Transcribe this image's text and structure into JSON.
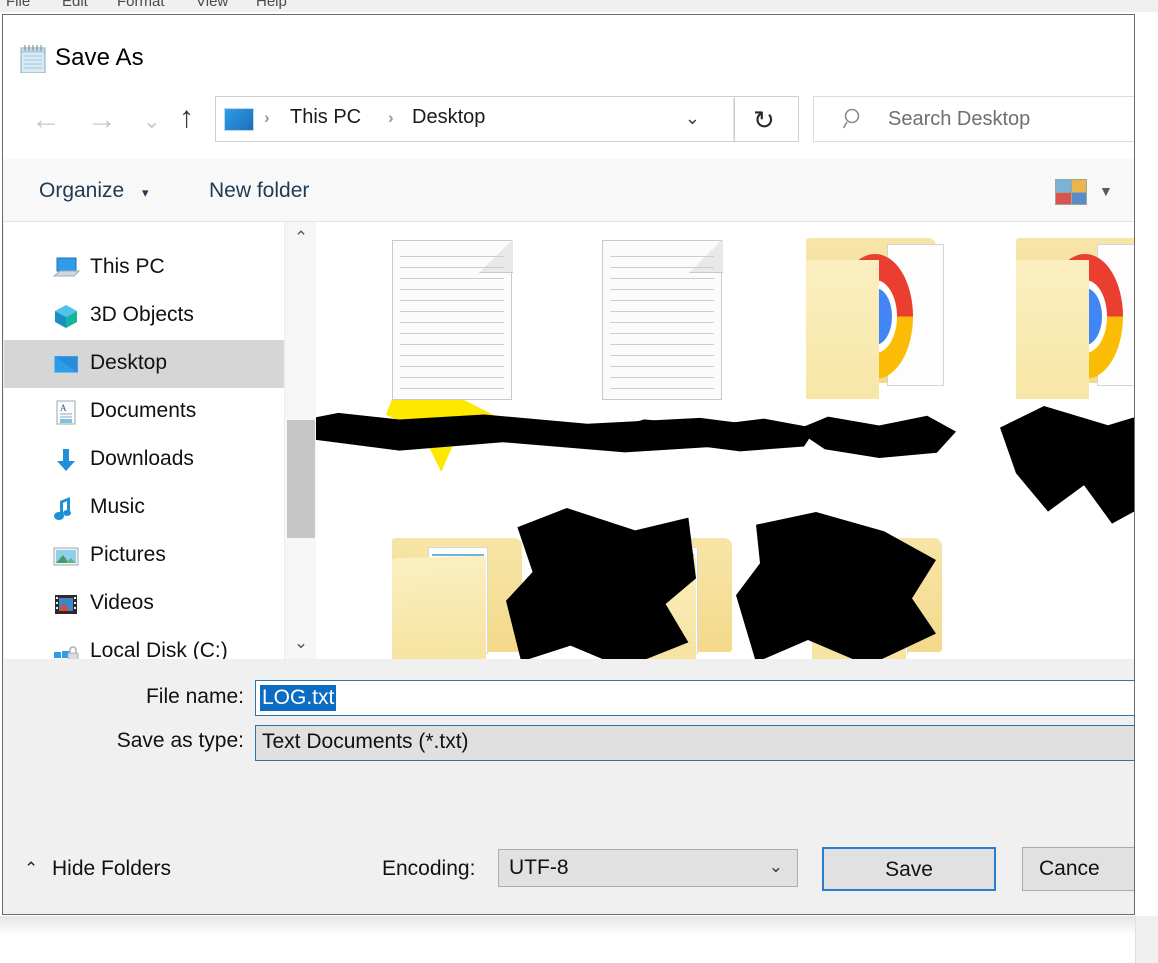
{
  "background_app": {
    "menubar": [
      "File",
      "Edit",
      "Format",
      "View",
      "Help"
    ]
  },
  "dialog": {
    "title": "Save As",
    "title_icon": "notepad-icon",
    "nav": {
      "back_icon": "arrow-left-icon",
      "forward_icon": "arrow-right-icon",
      "recent_icon": "chevron-down-icon",
      "up_icon": "arrow-up-icon",
      "breadcrumb": {
        "root_icon": "desktop-icon",
        "separator": "›",
        "items": [
          "This PC",
          "Desktop"
        ],
        "dropdown_icon": "chevron-down-icon"
      },
      "refresh_icon": "refresh-icon",
      "search": {
        "icon": "search-icon",
        "placeholder": "Search Desktop",
        "value": ""
      }
    },
    "toolbar": {
      "organize_label": "Organize",
      "organize_caret": "▾",
      "new_folder_label": "New folder",
      "view_icon": "view-layout-icon",
      "view_caret": "▾"
    },
    "sidebar": {
      "items": [
        {
          "label": "This PC",
          "icon": "this-pc-icon",
          "selected": false
        },
        {
          "label": "3D Objects",
          "icon": "3d-objects-icon",
          "selected": false
        },
        {
          "label": "Desktop",
          "icon": "desktop-icon",
          "selected": true
        },
        {
          "label": "Documents",
          "icon": "documents-icon",
          "selected": false
        },
        {
          "label": "Downloads",
          "icon": "downloads-icon",
          "selected": false
        },
        {
          "label": "Music",
          "icon": "music-icon",
          "selected": false
        },
        {
          "label": "Pictures",
          "icon": "pictures-icon",
          "selected": false
        },
        {
          "label": "Videos",
          "icon": "videos-icon",
          "selected": false
        },
        {
          "label": "Local Disk (C:)",
          "icon": "local-disk-icon",
          "selected": false
        }
      ],
      "scrollbar": {
        "up_arrow": "⌃",
        "down_arrow": "⌄"
      }
    },
    "file_list": {
      "note": "item names are obscured by black marker redaction",
      "items": [
        {
          "icon": "text-document-icon",
          "label": "",
          "redacted": true
        },
        {
          "icon": "text-document-icon",
          "label": "",
          "redacted": true
        },
        {
          "icon": "chrome-folder-icon",
          "label": "",
          "redacted": true
        },
        {
          "icon": "chrome-folder-icon",
          "label": "",
          "redacted": true
        },
        {
          "icon": "folder-icon",
          "label": "",
          "redacted": true
        },
        {
          "icon": "folder-icon",
          "label": "",
          "redacted": true
        },
        {
          "icon": "folder-icon",
          "label": "",
          "redacted": true
        }
      ]
    },
    "form": {
      "filename_label": "File name:",
      "filename_value": "LOG.txt",
      "savetype_label": "Save as type:",
      "savetype_value": "Text Documents (*.txt)"
    },
    "footer": {
      "hide_folders_label": "Hide Folders",
      "hide_folders_caret": "⌃",
      "encoding_label": "Encoding:",
      "encoding_value": "UTF-8",
      "encoding_caret": "⌄",
      "save_label": "Save",
      "cancel_label": "Cance"
    }
  },
  "colors": {
    "accent_blue": "#2b7dd0",
    "selection_blue": "#0b6cc2",
    "dialog_bg": "#f0f0f0",
    "selected_row": "#d6d6d6",
    "redaction": "#000000",
    "highlighter": "#ffe800"
  }
}
